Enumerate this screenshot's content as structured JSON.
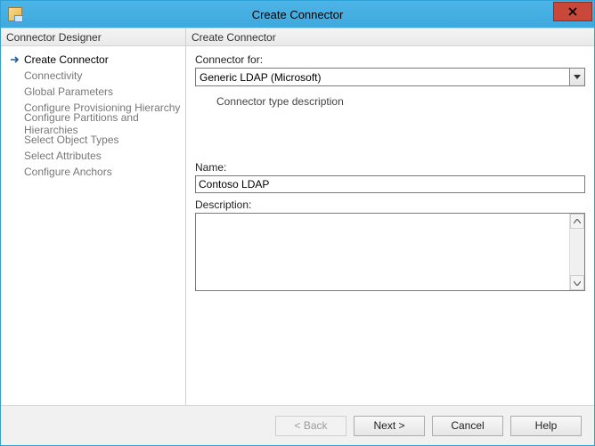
{
  "window": {
    "title": "Create Connector"
  },
  "sidebar": {
    "header": "Connector Designer",
    "items": [
      {
        "label": "Create Connector",
        "current": true
      },
      {
        "label": "Connectivity"
      },
      {
        "label": "Global Parameters"
      },
      {
        "label": "Configure Provisioning Hierarchy"
      },
      {
        "label": "Configure Partitions and Hierarchies"
      },
      {
        "label": "Select Object Types"
      },
      {
        "label": "Select Attributes"
      },
      {
        "label": "Configure Anchors"
      }
    ]
  },
  "main": {
    "header": "Create Connector",
    "connector_for_label": "Connector for:",
    "connector_for_value": "Generic LDAP (Microsoft)",
    "type_description": "Connector type description",
    "name_label": "Name:",
    "name_value": "Contoso LDAP",
    "description_label": "Description:",
    "description_value": ""
  },
  "footer": {
    "back": "<  Back",
    "next": "Next  >",
    "cancel": "Cancel",
    "help": "Help"
  }
}
